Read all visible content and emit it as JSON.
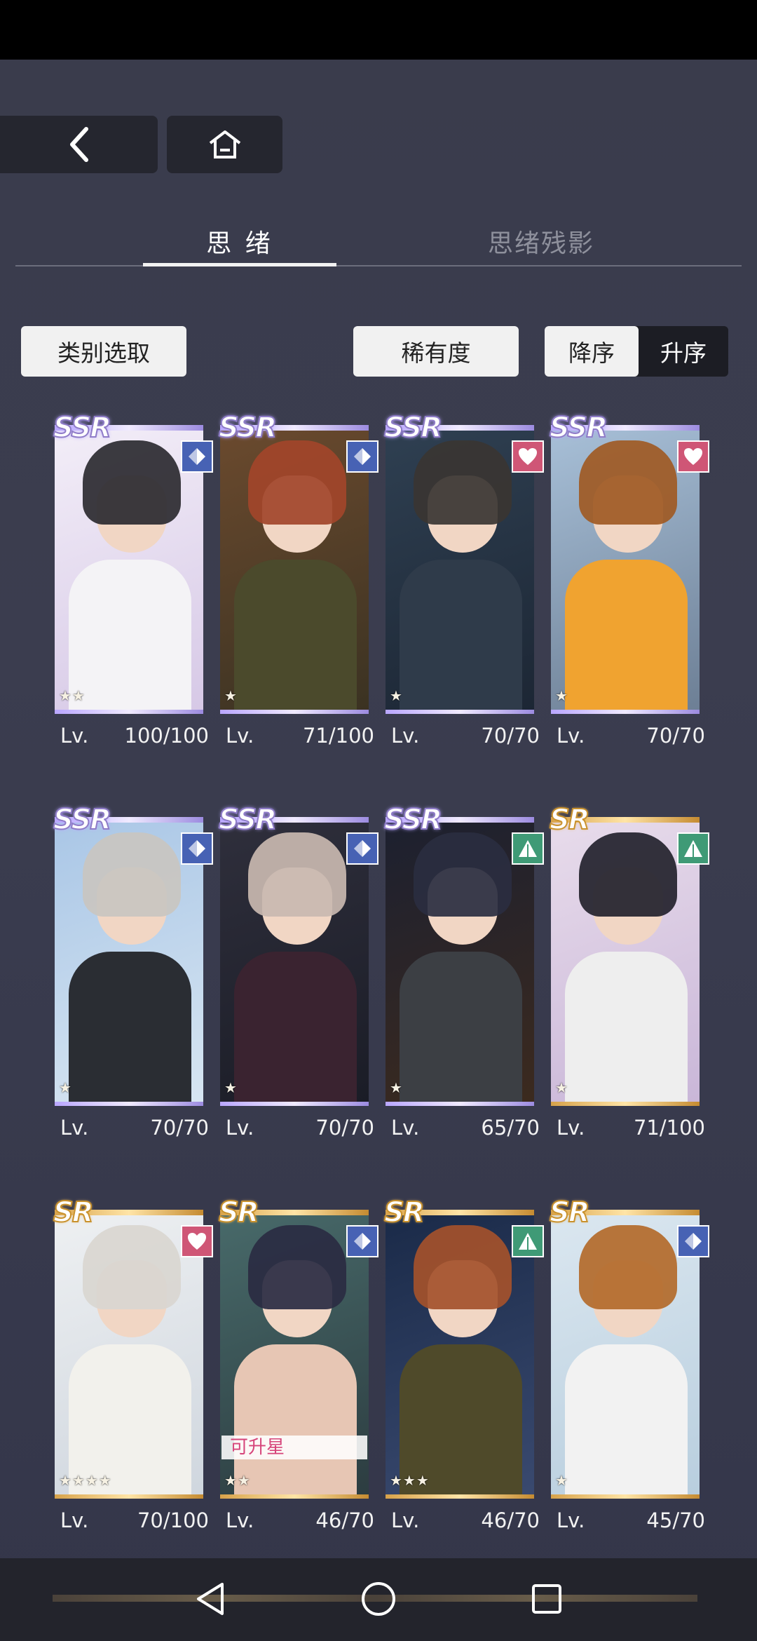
{
  "header": {
    "tabs": [
      {
        "label": "思 绪",
        "active": true
      },
      {
        "label": "思绪残影",
        "active": false
      }
    ]
  },
  "filters": {
    "category_label": "类别选取",
    "sort_label": "稀有度",
    "desc_label": "降序",
    "asc_label": "升序",
    "selected_order": "降序"
  },
  "cards": [
    {
      "rarity": "SSR",
      "attribute": "diamond-icon",
      "stars": "★★",
      "lv_label": "Lv.",
      "level": "100/100",
      "badge": ""
    },
    {
      "rarity": "SSR",
      "attribute": "diamond-icon",
      "stars": "★",
      "lv_label": "Lv.",
      "level": "71/100",
      "badge": ""
    },
    {
      "rarity": "SSR",
      "attribute": "heart-icon",
      "stars": "★",
      "lv_label": "Lv.",
      "level": "70/70",
      "badge": ""
    },
    {
      "rarity": "SSR",
      "attribute": "heart-icon",
      "stars": "★",
      "lv_label": "Lv.",
      "level": "70/70",
      "badge": ""
    },
    {
      "rarity": "SSR",
      "attribute": "diamond-icon",
      "stars": "★",
      "lv_label": "Lv.",
      "level": "70/70",
      "badge": ""
    },
    {
      "rarity": "SSR",
      "attribute": "diamond-icon",
      "stars": "★",
      "lv_label": "Lv.",
      "level": "70/70",
      "badge": ""
    },
    {
      "rarity": "SSR",
      "attribute": "triangle-icon",
      "stars": "★",
      "lv_label": "Lv.",
      "level": "65/70",
      "badge": ""
    },
    {
      "rarity": "SR",
      "attribute": "triangle-icon",
      "stars": "★",
      "lv_label": "Lv.",
      "level": "71/100",
      "badge": ""
    },
    {
      "rarity": "SR",
      "attribute": "heart-icon",
      "stars": "★★★★",
      "lv_label": "Lv.",
      "level": "70/100",
      "badge": ""
    },
    {
      "rarity": "SR",
      "attribute": "diamond-icon",
      "stars": "★★",
      "lv_label": "Lv.",
      "level": "46/70",
      "badge": "可升星"
    },
    {
      "rarity": "SR",
      "attribute": "triangle-icon",
      "stars": "★★★",
      "lv_label": "Lv.",
      "level": "46/70",
      "badge": ""
    },
    {
      "rarity": "SR",
      "attribute": "diamond-icon",
      "stars": "★",
      "lv_label": "Lv.",
      "level": "45/70",
      "badge": ""
    }
  ],
  "colors": {
    "attribute_blue": "#4762b4",
    "attribute_pink": "#cf5676",
    "attribute_green": "#3f9a76",
    "ssr_frame": "#b9a6ff",
    "sr_frame": "#d7a24a"
  }
}
